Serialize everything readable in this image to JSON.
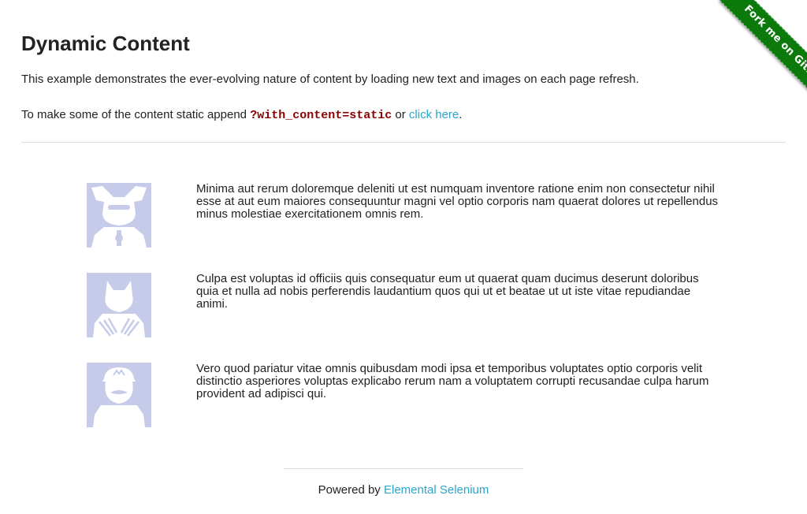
{
  "header": {
    "title": "Dynamic Content",
    "intro": "This example demonstrates the ever-evolving nature of content by loading new text and images on each page refresh.",
    "static_prefix": "To make some of the content static append",
    "static_param": "?with_content=static",
    "static_or": "or",
    "static_link": "click here",
    "static_suffix": "."
  },
  "rows": [
    {
      "avatar_icon": "jester-avatar-icon",
      "text": "Minima aut rerum doloremque deleniti ut est numquam inventore ratione enim non consectetur nihil esse at aut eum maiores consequuntur magni vel optio corporis nam quaerat dolores ut repellendus minus molestiae exercitationem omnis rem."
    },
    {
      "avatar_icon": "wolverine-avatar-icon",
      "text": "Culpa est voluptas id officiis quis consequatur eum ut quaerat quam ducimus deserunt doloribus quia et nulla ad nobis perferendis laudantium quos qui ut et beatae ut ut iste vitae repudiandae animi."
    },
    {
      "avatar_icon": "mario-avatar-icon",
      "text": "Vero quod pariatur vitae omnis quibusdam modi ipsa et temporibus voluptates optio corporis velit distinctio asperiores voluptas explicabo rerum nam a voluptatem corrupti recusandae culpa harum provident ad adipisci qui."
    }
  ],
  "footer": {
    "powered_by": "Powered by",
    "link": "Elemental Selenium"
  },
  "ribbon": {
    "label": "Fork me on GitHub"
  },
  "colors": {
    "link": "#2ba6cb",
    "code": "#8b0000",
    "avatar_bg": "#c5cbe9",
    "ribbon": "#0b7a0b"
  }
}
